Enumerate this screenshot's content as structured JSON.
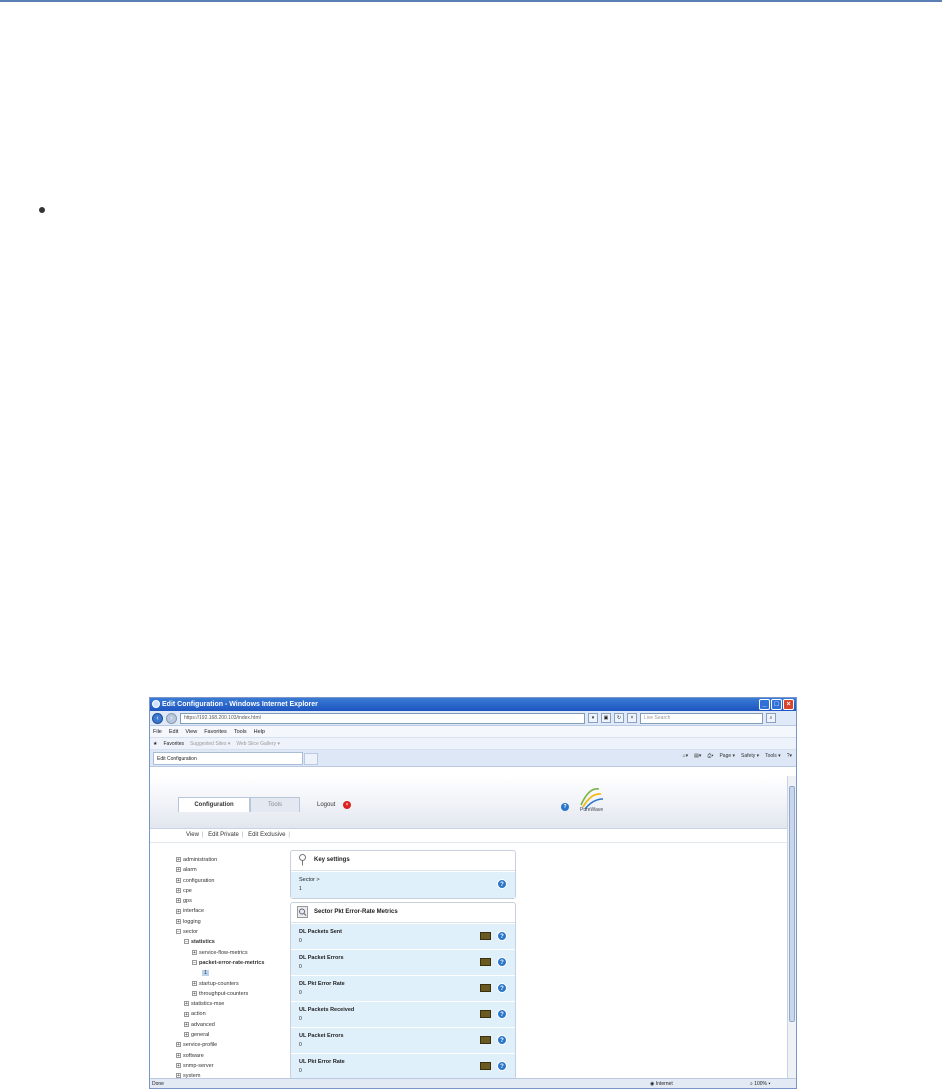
{
  "window": {
    "title": "Edit Configuration - Windows Internet Explorer",
    "address": "https://192.168.200.103/index.html",
    "search_placeholder": "Live Search",
    "menu": [
      "File",
      "Edit",
      "View",
      "Favorites",
      "Tools",
      "Help"
    ],
    "favorites": {
      "label": "Favorites",
      "suggested": "Suggested Sites ▾",
      "gallery": "Web Slice Gallery ▾"
    },
    "tab_label": "Edit Configuration",
    "command_bar": [
      "Page ▾",
      "Safety ▾",
      "Tools ▾"
    ],
    "status": {
      "left": "Done",
      "zone": "Internet",
      "zoom": "100%"
    }
  },
  "app": {
    "tabs": {
      "configuration": "Configuration",
      "tools": "Tools"
    },
    "logout": "Logout",
    "logo_text": "PureWave",
    "subnav": {
      "view": "View",
      "edit_private": "Edit Private",
      "edit_exclusive": "Edit Exclusive"
    }
  },
  "tree": [
    "administration",
    "alarm",
    "configuration",
    "cpe",
    "gps",
    "interface",
    "logging",
    "sector",
    "statistics",
    "service-flow-metrics",
    "packet-error-rate-metrics",
    "1",
    "startup-counters",
    "throughput-counters",
    "statistics-mse",
    "action",
    "advanced",
    "general",
    "service-profile",
    "software",
    "snmp-server",
    "system"
  ],
  "key_settings": {
    "title": "Key settings",
    "label": "Sector >",
    "value": "1"
  },
  "metrics": {
    "title": "Sector Pkt Error-Rate Metrics",
    "rows": [
      {
        "label": "DL Packets Sent",
        "value": "0"
      },
      {
        "label": "DL Packet Errors",
        "value": "0"
      },
      {
        "label": "DL Pkt Error Rate",
        "value": "0"
      },
      {
        "label": "UL Packets Received",
        "value": "0"
      },
      {
        "label": "UL Packet Errors",
        "value": "0"
      },
      {
        "label": "UL Pkt Error Rate",
        "value": "0"
      }
    ]
  },
  "colors": {
    "accent": "#2a76c9",
    "row_bg": "#dff0fb",
    "titlebar": "#1d55c0"
  }
}
